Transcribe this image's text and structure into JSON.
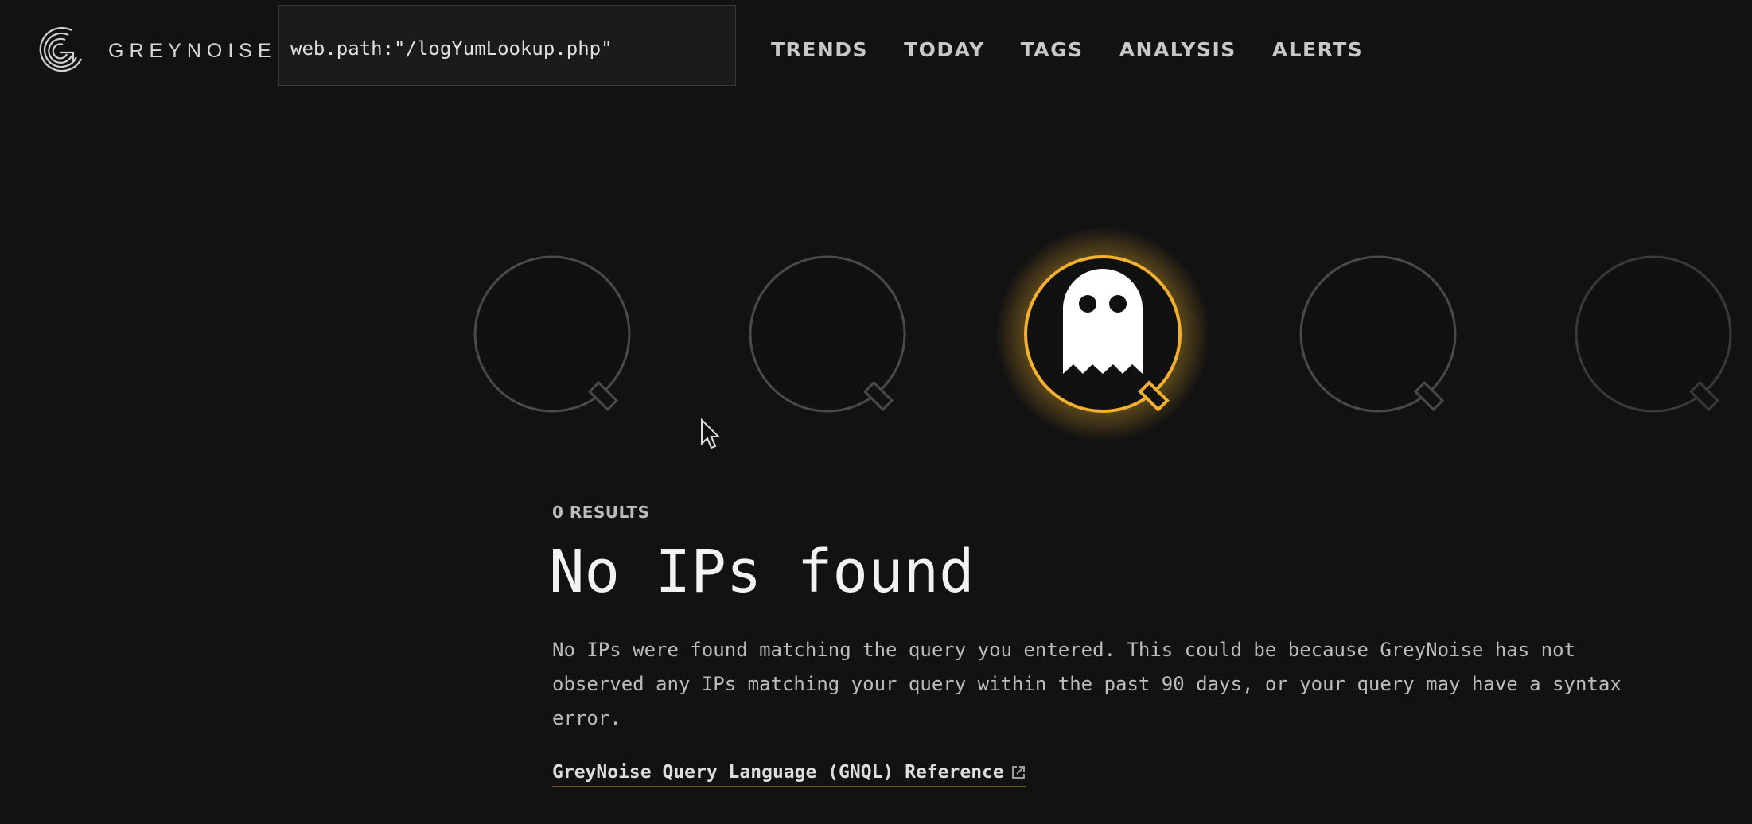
{
  "header": {
    "brand": "GREYNOISE",
    "search": {
      "value": "web.path:\"/logYumLookup.php\""
    },
    "nav": [
      "TRENDS",
      "TODAY",
      "TAGS",
      "ANALYSIS",
      "ALERTS"
    ]
  },
  "carousel": {
    "lens_count": 5,
    "active_index": 2,
    "active_icon": "ghost-icon",
    "accent_color": "#f2b02e"
  },
  "results": {
    "count_label": "0 RESULTS",
    "title": "No IPs found",
    "description": "No IPs were found matching the query you entered. This could be because GreyNoise has not observed any IPs matching your query within the past 90 days, or your query may have a syntax error.",
    "reference_link": "GreyNoise Query Language (GNQL) Reference"
  }
}
